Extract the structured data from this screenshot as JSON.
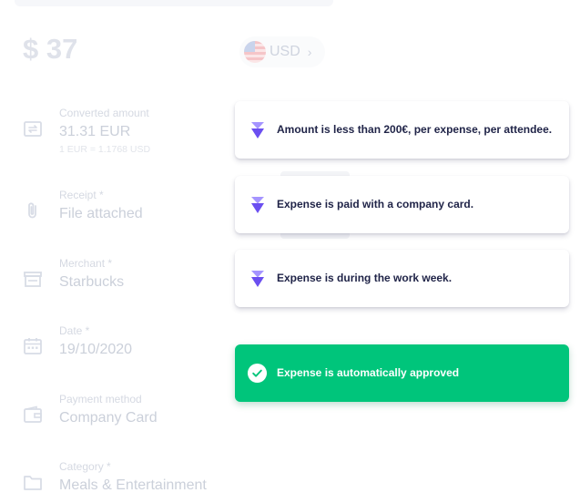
{
  "expense": {
    "amount": "$ 37",
    "currency": {
      "code": "USD",
      "flag_icon": "us-flag-icon",
      "chevron_icon": "chevron-right-icon"
    }
  },
  "fields": [
    {
      "label": "Converted amount",
      "value": "31.31 EUR",
      "sub": "1 EUR = 1.1768 USD",
      "icon": "exchange-icon"
    },
    {
      "label": "Receipt *",
      "value": "File attached",
      "icon": "paperclip-icon"
    },
    {
      "label": "Merchant *",
      "value": "Starbucks",
      "icon": "store-icon"
    },
    {
      "label": "Date *",
      "value": "19/10/2020",
      "icon": "calendar-icon"
    },
    {
      "label": "Payment method",
      "value": "Company Card",
      "icon": "wallet-icon"
    },
    {
      "label": "Category *",
      "value": "Meals & Entertainment",
      "icon": "folder-icon"
    }
  ],
  "rules": [
    {
      "text": "Amount is less than 200€, per expense, per attendee.",
      "icon": "chevrons-down-icon"
    },
    {
      "text": "Expense is paid with a company card.",
      "icon": "chevrons-down-icon"
    },
    {
      "text": "Expense is during the work week.",
      "icon": "chevrons-down-icon"
    }
  ],
  "result": {
    "text": "Expense is automatically approved",
    "icon": "check-circle-icon"
  },
  "colors": {
    "approved": "#00c57b",
    "rule_icon": "#7b61ff",
    "rule_text": "#1f2347",
    "muted_text": "#cbd0da"
  }
}
